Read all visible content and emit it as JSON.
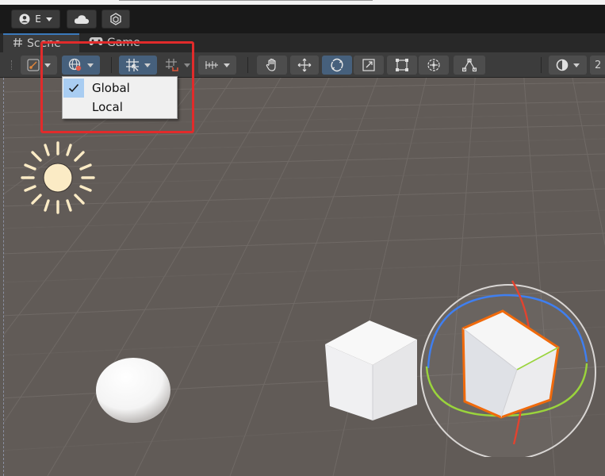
{
  "account_toolbar": {
    "account_label": "E",
    "icons": [
      "user-icon",
      "chevron-down-icon",
      "cloud-icon",
      "package-icon"
    ]
  },
  "tabs": [
    {
      "label": "Scene",
      "icon": "hash-icon",
      "active": true
    },
    {
      "label": "Game",
      "icon": "gamepad-icon",
      "active": false
    }
  ],
  "scene_toolbar": {
    "tools": [
      "pivot-tool",
      "global-local-toggle",
      "grid-snap-toggle",
      "snap-increment",
      "ruler",
      "hand-tool",
      "move-tool",
      "rotate-tool",
      "scale-tool",
      "rect-tool",
      "transform-tool",
      "custom-editor-tool",
      "shading-mode"
    ],
    "active_tool": "rotate-tool",
    "right_label": "2"
  },
  "dropdown": {
    "items": [
      {
        "label": "Global",
        "checked": true
      },
      {
        "label": "Local",
        "checked": false
      }
    ]
  },
  "colors": {
    "viewport": "#615b57",
    "active_toggle": "#46607c",
    "selection_outline": "#f06a0c",
    "annotation": "#e12b2b"
  }
}
